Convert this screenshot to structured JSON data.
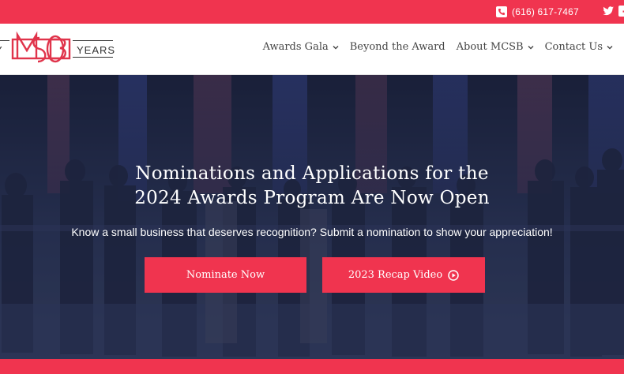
{
  "topbar": {
    "phone": "(616) 617-7467",
    "phone_icon": "phone-icon",
    "social_icons": [
      "twitter-icon",
      "facebook-icon"
    ]
  },
  "header": {
    "logo": {
      "text_left": "Y",
      "text_right": "YEARS",
      "monogram": "MCSB"
    },
    "nav": [
      {
        "label": "Awards Gala",
        "has_dropdown": true
      },
      {
        "label": "Beyond the Award",
        "has_dropdown": false
      },
      {
        "label": "About MCSB",
        "has_dropdown": true
      },
      {
        "label": "Contact Us",
        "has_dropdown": true
      }
    ]
  },
  "hero": {
    "title_line1": "Nominations and Applications for the",
    "title_line2": "2024 Awards Program Are Now Open",
    "subtitle": "Know a small business that deserves recognition? Submit a nomination to show your appreciation!",
    "buttons": {
      "nominate": "Nominate Now",
      "recap": "2023 Recap Video"
    }
  },
  "colors": {
    "accent": "#f0344f",
    "hero_overlay": "#1e2640",
    "nav_text": "#444444"
  }
}
